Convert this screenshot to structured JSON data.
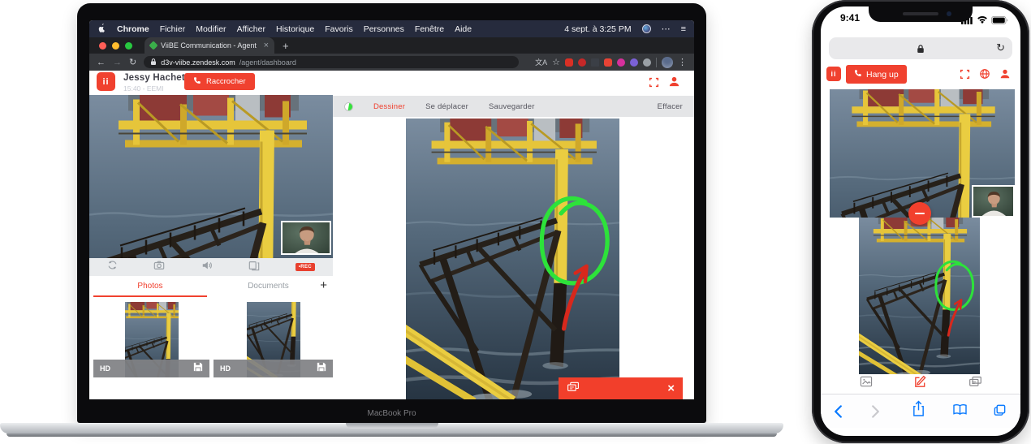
{
  "mac": {
    "menu_bar": {
      "items": [
        "Chrome",
        "Fichier",
        "Modifier",
        "Afficher",
        "Historique",
        "Favoris",
        "Personnes",
        "Fenêtre",
        "Aide"
      ],
      "clock": "4 sept. à 3:25 PM"
    },
    "chrome": {
      "tab_title": "ViiBE Communication - Agent",
      "url_domain": "d3v-viibe.zendesk.com",
      "url_path": "/agent/dashboard"
    },
    "app": {
      "logo": "ii",
      "agent_name": "Jessy Hachet",
      "call_info": "15:40 - EEMI",
      "hangup_label": "Raccrocher",
      "toolbar": {
        "draw": "Dessiner",
        "move": "Se déplacer",
        "save": "Sauvegarder",
        "erase": "Effacer"
      },
      "rec_label": "•REC",
      "tabs": {
        "photos": "Photos",
        "documents": "Documents",
        "add": "+"
      },
      "thumbnails": [
        {
          "quality": "HD"
        },
        {
          "quality": "HD"
        }
      ]
    },
    "device_label": "MacBook Pro"
  },
  "phone": {
    "status_time": "9:41",
    "app": {
      "logo": "ii",
      "hangup_label": "Hang up"
    }
  },
  "colors": {
    "viibe_red": "#f0412f",
    "annotation_green": "#2de23a",
    "annotation_red": "#d8281c",
    "ios_blue": "#0a7aff"
  }
}
